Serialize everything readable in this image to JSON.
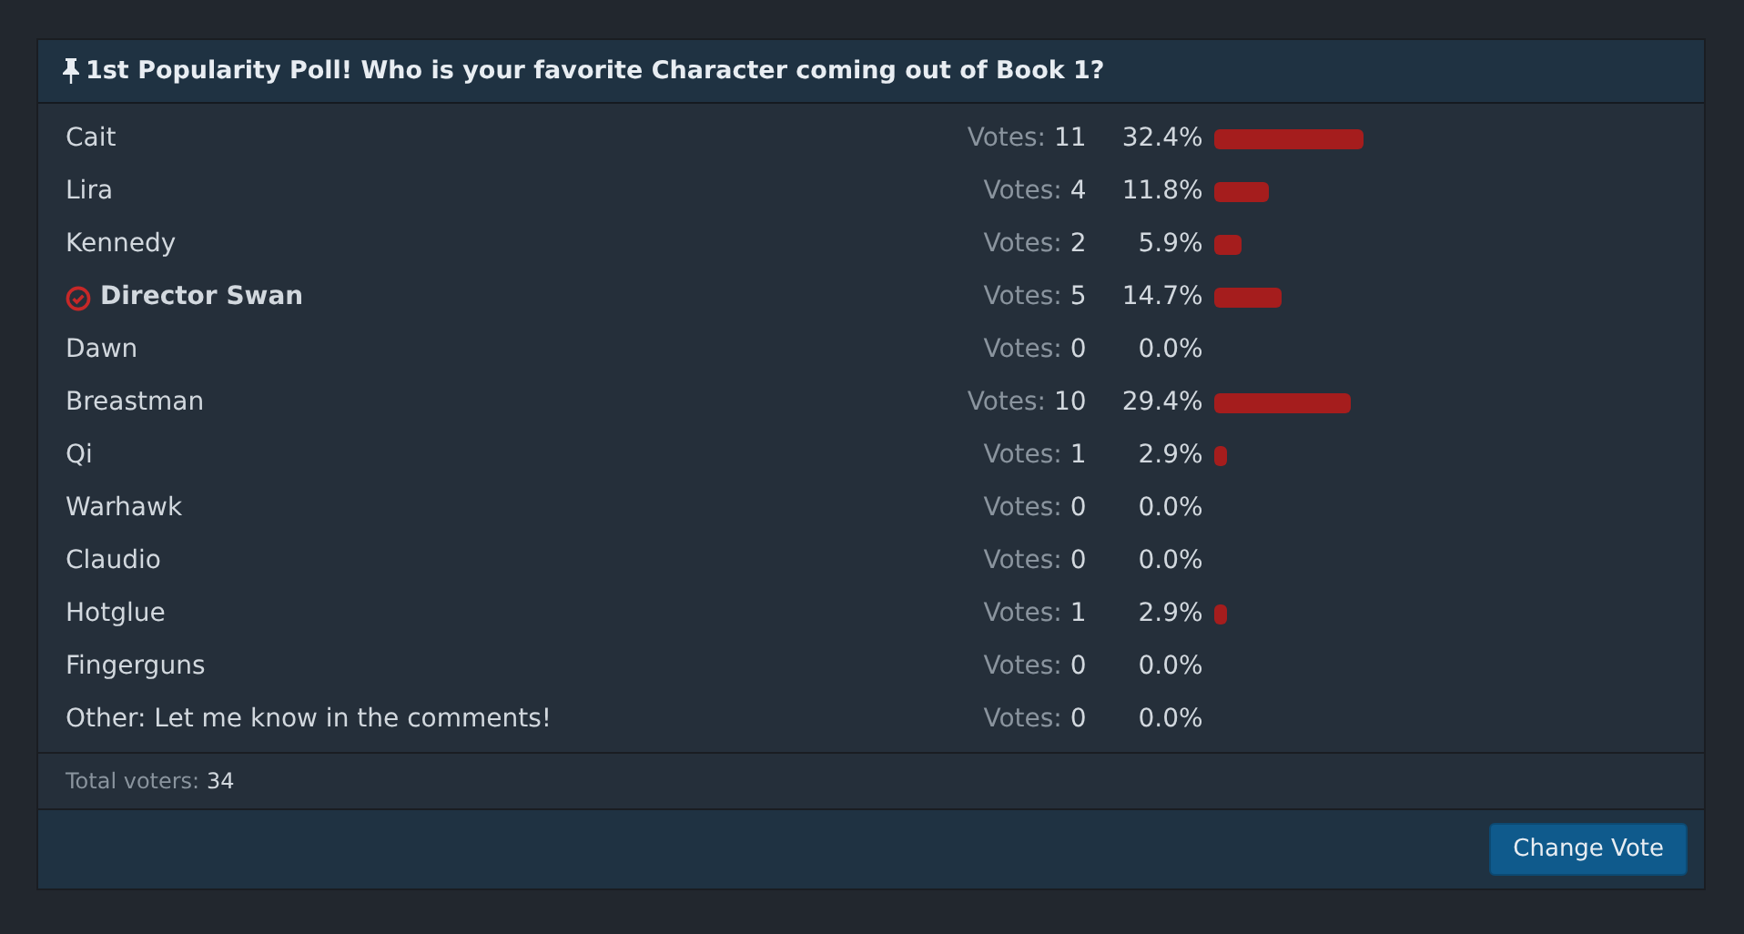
{
  "poll": {
    "title": "1st Popularity Poll! Who is your favorite Character coming out of Book 1?",
    "options": [
      {
        "label": "Cait",
        "votes_label": "Votes:",
        "votes": "11",
        "percent": "32.4%",
        "selected": false
      },
      {
        "label": "Lira",
        "votes_label": "Votes:",
        "votes": "4",
        "percent": "11.8%",
        "selected": false
      },
      {
        "label": "Kennedy",
        "votes_label": "Votes:",
        "votes": "2",
        "percent": "5.9%",
        "selected": false
      },
      {
        "label": "Director Swan",
        "votes_label": "Votes:",
        "votes": "5",
        "percent": "14.7%",
        "selected": true
      },
      {
        "label": "Dawn",
        "votes_label": "Votes:",
        "votes": "0",
        "percent": "0.0%",
        "selected": false
      },
      {
        "label": "Breastman",
        "votes_label": "Votes:",
        "votes": "10",
        "percent": "29.4%",
        "selected": false
      },
      {
        "label": "Qi",
        "votes_label": "Votes:",
        "votes": "1",
        "percent": "2.9%",
        "selected": false
      },
      {
        "label": "Warhawk",
        "votes_label": "Votes:",
        "votes": "0",
        "percent": "0.0%",
        "selected": false
      },
      {
        "label": "Claudio",
        "votes_label": "Votes:",
        "votes": "0",
        "percent": "0.0%",
        "selected": false
      },
      {
        "label": "Hotglue",
        "votes_label": "Votes:",
        "votes": "1",
        "percent": "2.9%",
        "selected": false
      },
      {
        "label": "Fingerguns",
        "votes_label": "Votes:",
        "votes": "0",
        "percent": "0.0%",
        "selected": false
      },
      {
        "label": "Other: Let me know in the comments!",
        "votes_label": "Votes:",
        "votes": "0",
        "percent": "0.0%",
        "selected": false
      }
    ],
    "total_label": "Total voters:",
    "total": "34",
    "button": "Change Vote"
  }
}
